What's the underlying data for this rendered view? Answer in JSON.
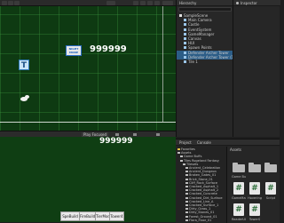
{
  "scene": {
    "score": "999999",
    "sprite_label": "NIGHT\nMODE"
  },
  "game_view": {
    "tab_label": "Play Focused",
    "score": "999999",
    "buttons": [
      "SpeBuild",
      "FireBuild",
      "TierMod",
      "Tower4"
    ]
  },
  "hierarchy": {
    "tab": "Hierarchy",
    "items": [
      {
        "label": "SampleScene",
        "depth": 0
      },
      {
        "label": "Main Camera",
        "depth": 1
      },
      {
        "label": "Castle",
        "depth": 1
      },
      {
        "label": "EventSystem",
        "depth": 1
      },
      {
        "label": "GameManager",
        "depth": 1
      },
      {
        "label": "Canvas",
        "depth": 1
      },
      {
        "label": "HUI",
        "depth": 1
      },
      {
        "label": "Spawn Points",
        "depth": 1
      },
      {
        "label": "Defender Archer Tower",
        "depth": 1
      },
      {
        "label": "Defender Archer Tower (1)",
        "depth": 1
      },
      {
        "label": "Tile 1",
        "depth": 1
      }
    ]
  },
  "inspector": {
    "tab": "Inspector"
  },
  "project": {
    "tabs": [
      "Project",
      "Console"
    ],
    "tree": [
      {
        "label": "Favorites",
        "depth": 0
      },
      {
        "label": "Assets",
        "depth": 0
      },
      {
        "label": "Game Buffs",
        "depth": 1
      },
      {
        "label": "Tiles Rogeland Fantasy",
        "depth": 1
      },
      {
        "label": "Tilesets",
        "depth": 2
      },
      {
        "label": "Ancient_Celebration",
        "depth": 3
      },
      {
        "label": "Ancient_Dungeon",
        "depth": 3
      },
      {
        "label": "Broken_Gates_01",
        "depth": 3
      },
      {
        "label": "Brick_Stone_01",
        "depth": 3
      },
      {
        "label": "Cliff_Rock_Surface",
        "depth": 3
      },
      {
        "label": "Cracked_Asphalt_1",
        "depth": 3
      },
      {
        "label": "Cracked_Asphalt_2",
        "depth": 3
      },
      {
        "label": "Cracked_Concrete",
        "depth": 3
      },
      {
        "label": "Cracked_Dirt_Surface",
        "depth": 3
      },
      {
        "label": "Cracked_Line_A",
        "depth": 3
      },
      {
        "label": "Cracked_Surface_1",
        "depth": 3
      },
      {
        "label": "Dirty_Grass_1",
        "depth": 3
      },
      {
        "label": "Dirty_Stones_01",
        "depth": 3
      },
      {
        "label": "Forest_Ground_01",
        "depth": 3
      },
      {
        "label": "Flora_Floor_01",
        "depth": 3
      }
    ],
    "assets_header": "Assets",
    "assets": [
      {
        "kind": "folder",
        "label": "Game Buff"
      },
      {
        "kind": "folder",
        "label": ""
      },
      {
        "kind": "folder",
        "label": ""
      },
      {
        "kind": "script",
        "label": "GameMan"
      },
      {
        "kind": "script",
        "label": "Hovering"
      },
      {
        "kind": "script",
        "label": "Script"
      },
      {
        "kind": "script",
        "label": "ReaderUI"
      },
      {
        "kind": "script",
        "label": "TowerS"
      }
    ]
  },
  "colors": {
    "scene_bg": "#0e3a12",
    "game_bg": "#0f3e13",
    "selection": "#2c5d87"
  }
}
